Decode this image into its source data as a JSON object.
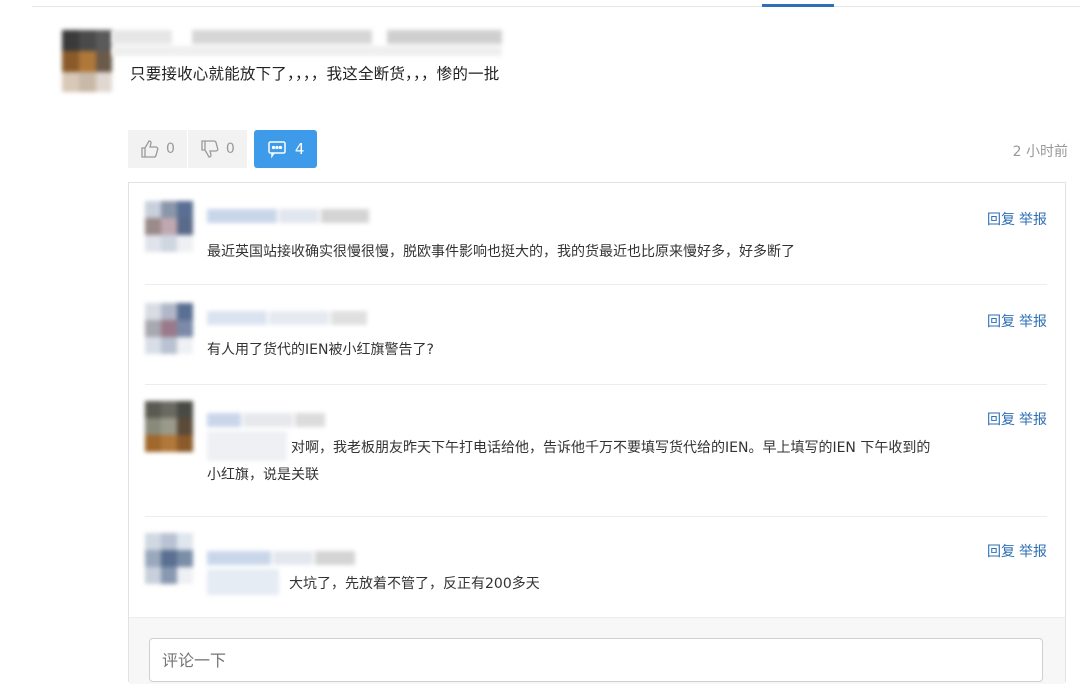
{
  "post": {
    "text": "只要接收心就能放下了，，，，我这全断货，，，惨的一批",
    "likes": "0",
    "dislikes": "0",
    "comment_count": "4",
    "time": "2 小时前"
  },
  "comments": [
    {
      "text": "最近英国站接收确实很慢很慢，脱欧事件影响也挺大的，我的货最近也比原来慢好多，好多断了",
      "reply": "回复",
      "report": "举报"
    },
    {
      "text": "有人用了货代的IEN被小红旗警告了?",
      "reply": "回复",
      "report": "举报"
    },
    {
      "text_line1": "对啊，我老板朋友昨天下午打电话给他，告诉他千万不要填写货代给的IEN。早上填写的IEN 下午收到的",
      "text_line2": "小红旗，说是关联",
      "reply": "回复",
      "report": "举报"
    },
    {
      "text": "大坑了，先放着不管了，反正有200多天",
      "reply": "回复",
      "report": "举报"
    }
  ],
  "comment_input": {
    "placeholder": "评论一下"
  },
  "colors": {
    "accent": "#3d9be9",
    "link": "#2f6fb5"
  }
}
